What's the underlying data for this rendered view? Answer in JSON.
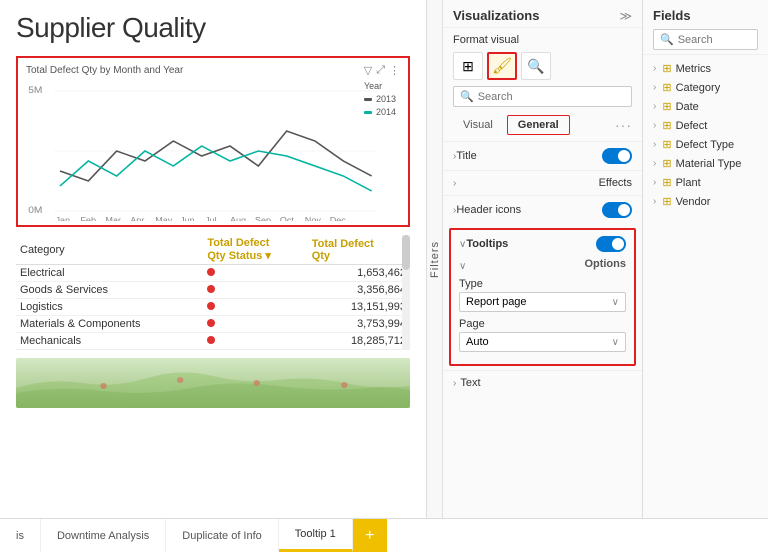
{
  "reportTitle": "Supplier Quality",
  "chart": {
    "title": "Total Defect Qty by Month and Year",
    "yLabel5m": "5M",
    "yLabel0m": "0M",
    "months": [
      "Jan",
      "Feb",
      "Mar",
      "Apr",
      "May",
      "Jun",
      "Jul",
      "Aug",
      "Sep",
      "Oct",
      "Nov",
      "Dec"
    ],
    "legendTitle": "Year",
    "legend2013": "2013",
    "legend2014": "2014",
    "filterIcon": "▼",
    "expandIcon": "⤢",
    "dotsIcon": "⋮"
  },
  "table": {
    "columns": [
      "Category",
      "Total Defect\nQty Status",
      "Total Defect\nQty"
    ],
    "rows": [
      {
        "category": "Electrical",
        "qty": "1,653,462"
      },
      {
        "category": "Goods & Services",
        "qty": "3,356,864"
      },
      {
        "category": "Logistics",
        "qty": "13,151,993"
      },
      {
        "category": "Materials & Components",
        "qty": "3,753,994"
      },
      {
        "category": "Mechanicals",
        "qty": "18,285,712"
      }
    ]
  },
  "filters": {
    "label": "Filters"
  },
  "vizPanel": {
    "title": "Visualizations",
    "expandIcon": "≫",
    "formatVisualLabel": "Format visual",
    "icons": [
      {
        "name": "grid-icon",
        "symbol": "⊞"
      },
      {
        "name": "paint-icon",
        "symbol": "🖌",
        "active": true
      },
      {
        "name": "analytics-icon",
        "symbol": "🔍"
      }
    ],
    "search": {
      "placeholder": "Search",
      "icon": "🔍"
    },
    "tabs": [
      {
        "label": "Visual",
        "active": false
      },
      {
        "label": "General",
        "active": true
      }
    ],
    "sections": [
      {
        "label": "Title",
        "toggle": true,
        "chevron": ">",
        "expanded": false
      },
      {
        "label": "Effects",
        "toggle": false,
        "chevron": ">",
        "expanded": false
      },
      {
        "label": "Header icons",
        "toggle": true,
        "chevron": ">",
        "expanded": false
      },
      {
        "label": "Tooltips",
        "toggle": true,
        "chevron": "∨",
        "expanded": true,
        "highlighted": true,
        "subsections": [
          {
            "label": "Options",
            "fields": [
              {
                "label": "Type",
                "dropdownValue": "Report page",
                "dropdownArrow": "∨"
              },
              {
                "label": "Page",
                "dropdownValue": "Auto",
                "dropdownArrow": "∨"
              }
            ]
          }
        ]
      },
      {
        "label": "Text",
        "toggle": false,
        "chevron": ">",
        "expanded": false
      }
    ]
  },
  "fieldsPanel": {
    "title": "Fields",
    "search": {
      "placeholder": "Search",
      "icon": "🔍"
    },
    "items": [
      {
        "label": "Metrics",
        "icon": "⊞",
        "expand": ">"
      },
      {
        "label": "Category",
        "icon": "⊞",
        "expand": ">"
      },
      {
        "label": "Date",
        "icon": "⊞",
        "expand": ">"
      },
      {
        "label": "Defect",
        "icon": "⊞",
        "expand": ">"
      },
      {
        "label": "Defect Type",
        "icon": "⊞",
        "expand": ">"
      },
      {
        "label": "Material Type",
        "icon": "⊞",
        "expand": ">"
      },
      {
        "label": "Plant",
        "icon": "⊞",
        "expand": ">"
      },
      {
        "label": "Vendor",
        "icon": "⊞",
        "expand": ">"
      }
    ]
  },
  "tabBar": {
    "tabs": [
      {
        "label": "is",
        "active": false
      },
      {
        "label": "Downtime Analysis",
        "active": false
      },
      {
        "label": "Duplicate of Info",
        "active": false
      },
      {
        "label": "Tooltip 1",
        "active": true
      }
    ],
    "addIcon": "+"
  }
}
